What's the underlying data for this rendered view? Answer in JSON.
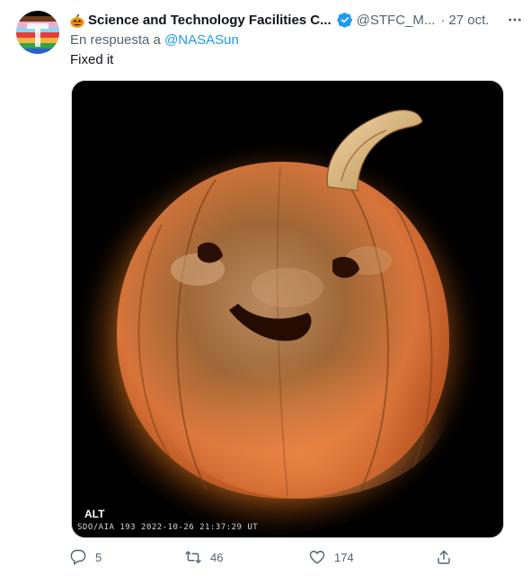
{
  "author": {
    "name": "Science and Technology Facilities C...",
    "handle": "@STFC_M...",
    "time": "27 oct.",
    "dot": "·"
  },
  "reply": {
    "prefix": "En respuesta a ",
    "mention": "@NASASun"
  },
  "tweet": {
    "text": "Fixed it"
  },
  "media": {
    "alt_badge": "ALT",
    "caption": "SDO/AIA  193    2022-10-26 21:37:29 UT"
  },
  "actions": {
    "replies": "5",
    "retweets": "46",
    "likes": "174"
  },
  "colors": {
    "link": "#1d9bf0",
    "secondary_text": "#536471",
    "verified": "#1d9bf0"
  },
  "icons": [
    "pumpkin-emoji-icon",
    "verified-badge-icon",
    "more-icon",
    "reply-icon",
    "retweet-icon",
    "like-icon",
    "share-icon"
  ]
}
